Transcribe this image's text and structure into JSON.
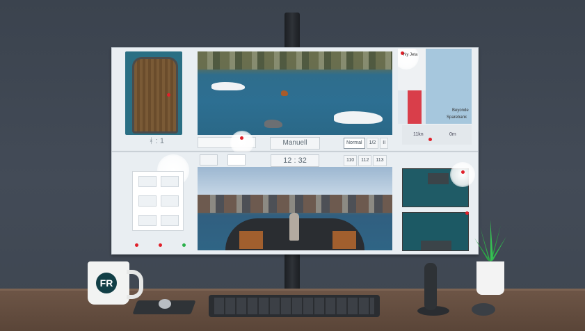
{
  "top_screen": {
    "crew_count": "1",
    "crew_label": "ᚼ : 1",
    "mode_button": "Manuell",
    "speed_options": [
      "Normal",
      "1/2",
      "II"
    ],
    "map": {
      "label_top": "Ny Jeta",
      "label_side": "Beyonde",
      "label_bottom": "Sparebank"
    },
    "gauges": [
      {
        "label": "11",
        "unit": "kn"
      },
      {
        "label": "0",
        "unit": "m"
      }
    ]
  },
  "bottom_screen": {
    "clock": "12 : 32",
    "channels": [
      "110",
      "112",
      "113"
    ]
  },
  "colors": {
    "alert": "#e0202a",
    "water": "#2d6f92",
    "ui_bg": "#e9eef2"
  },
  "mug_logo": "FR"
}
